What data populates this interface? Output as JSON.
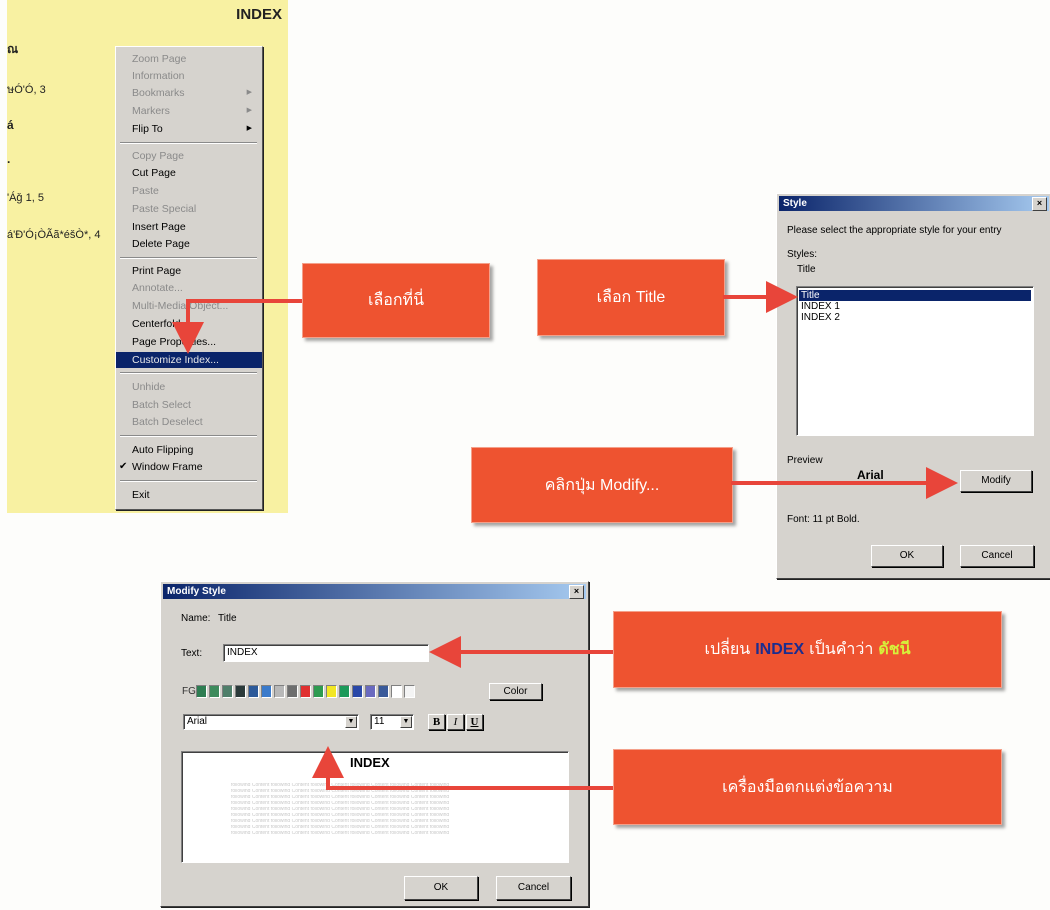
{
  "index_page": {
    "title": "INDEX",
    "entries": [
      "ณ",
      "ษÓ'Ó, 3",
      "á",
      "·",
      "'Áǧ 1, 5",
      "á'Ð'Ó¡ÒÃã*éšÒ*, 4"
    ]
  },
  "context_menu": {
    "items": [
      {
        "label": "Zoom Page",
        "disabled": true
      },
      {
        "label": "Information",
        "disabled": true
      },
      {
        "label": "Bookmarks",
        "disabled": true,
        "submenu": "▶"
      },
      {
        "label": "Markers",
        "disabled": true,
        "submenu": "▶"
      },
      {
        "label": "Flip To",
        "disabled": false,
        "submenu": "▶"
      },
      {
        "label": "Copy Page",
        "disabled": true
      },
      {
        "label": "Cut Page",
        "disabled": false
      },
      {
        "label": "Paste",
        "disabled": true
      },
      {
        "label": "Paste Special",
        "disabled": true
      },
      {
        "label": "Insert Page",
        "disabled": false
      },
      {
        "label": "Delete Page",
        "disabled": false
      },
      {
        "label": "Print Page",
        "disabled": false
      },
      {
        "label": "Annotate...",
        "disabled": true
      },
      {
        "label": "Multi-Media Object...",
        "disabled": true
      },
      {
        "label": "Centerfold",
        "disabled": false
      },
      {
        "label": "Page Properties...",
        "disabled": false
      },
      {
        "label": "Customize Index...",
        "disabled": false,
        "selected": true
      },
      {
        "label": "Unhide",
        "disabled": true
      },
      {
        "label": "Batch Select",
        "disabled": true
      },
      {
        "label": "Batch Deselect",
        "disabled": true
      },
      {
        "label": "Auto Flipping",
        "disabled": false
      },
      {
        "label": "Window Frame",
        "disabled": false,
        "checked": "✔"
      },
      {
        "label": "Exit",
        "disabled": false
      }
    ]
  },
  "callouts": {
    "select_here": "เลือกที่นี่",
    "select_title": "เลือก Title",
    "click_modify": "คลิกปุ่ม Modify...",
    "change_index_prefix": "เปลี่ยน",
    "change_index_keyword": "INDEX",
    "change_index_middle": "เป็นคำว่า",
    "change_index_target": "ดัชนี",
    "text_tools": "เครื่องมือตกแต่งข้อความ"
  },
  "style_dialog": {
    "title": "Style",
    "close": "×",
    "instruction": "Please select the appropriate style for your entry",
    "styles_label": "Styles:",
    "current_style": "Title",
    "list_items": [
      "Title",
      "INDEX 1",
      "INDEX 2"
    ],
    "selected_index": 0,
    "preview_label": "Preview",
    "preview_font": "Arial",
    "modify_button": "Modify",
    "font_info": "Font: 11 pt Bold.",
    "ok_button": "OK",
    "cancel_button": "Cancel"
  },
  "modify_dialog": {
    "title": "Modify Style",
    "close": "×",
    "name_label": "Name:",
    "name_value": "Title",
    "text_label": "Text:",
    "text_value": "INDEX",
    "fg_label": "FG",
    "color_button": "Color",
    "swatches": [
      "#2e7d52",
      "#3d8b5c",
      "#4f7f6a",
      "#2b3a3a",
      "#2d5a9a",
      "#3a7acb",
      "#b8b8b8",
      "#6e6e6e",
      "#e03030",
      "#2e9b50",
      "#f2e624",
      "#1c9a5a",
      "#2a48a8",
      "#6a6abf",
      "#3a5a9a",
      "#ffffff",
      "#f4f4f4"
    ],
    "font_value": "Arial",
    "size_value": "11",
    "bold": "B",
    "italic": "I",
    "underline": "U",
    "preview_title": "INDEX",
    "preview_text": "following Content following Content following Content following Content following Content following",
    "ok_button": "OK",
    "cancel_button": "Cancel"
  },
  "colors": {
    "callout": "#ee5330",
    "arrow": "#e8453a",
    "selection": "#0a246a",
    "page": "#f8f1a2"
  }
}
